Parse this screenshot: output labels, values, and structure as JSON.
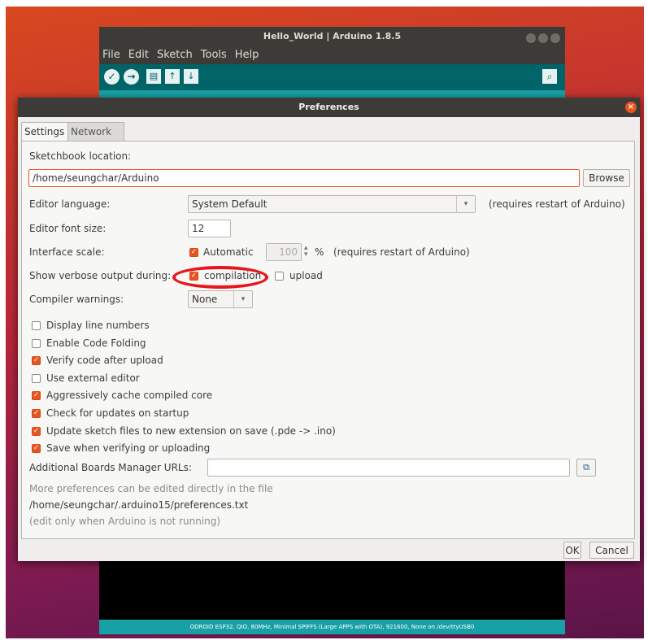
{
  "ide": {
    "title": "Hello_World | Arduino 1.8.5",
    "menu": [
      "File",
      "Edit",
      "Sketch",
      "Tools",
      "Help"
    ],
    "toolbar_icons": [
      "verify-icon",
      "upload-icon",
      "new-icon",
      "open-icon",
      "save-icon"
    ],
    "serial_icon": "serial-monitor-icon",
    "status": "ODROID ESP32, QIO, 80MHz, Minimal SPIFFS (Large APPS with OTA), 921600, None on /dev/ttyUSB0"
  },
  "prefs": {
    "title": "Preferences",
    "tabs": [
      "Settings",
      "Network"
    ],
    "sketchbook_label": "Sketchbook location:",
    "sketchbook_value": "/home/seungchar/Arduino",
    "browse_label": "Browse",
    "editor_language_label": "Editor language:",
    "editor_language_value": "System Default",
    "editor_language_note": "(requires restart of Arduino)",
    "font_size_label": "Editor font size:",
    "font_size_value": "12",
    "interface_scale_label": "Interface scale:",
    "interface_scale_auto": "Automatic",
    "interface_scale_value": "100",
    "interface_scale_unit": "%",
    "interface_scale_note": "(requires restart of Arduino)",
    "verbose_label": "Show verbose output during:",
    "verbose_compilation": "compilation",
    "verbose_upload": "upload",
    "warnings_label": "Compiler warnings:",
    "warnings_value": "None",
    "options": [
      {
        "label": "Display line numbers",
        "checked": false
      },
      {
        "label": "Enable Code Folding",
        "checked": false
      },
      {
        "label": "Verify code after upload",
        "checked": true
      },
      {
        "label": "Use external editor",
        "checked": false
      },
      {
        "label": "Aggressively cache compiled core",
        "checked": true
      },
      {
        "label": "Check for updates on startup",
        "checked": true
      },
      {
        "label": "Update sketch files to new extension on save (.pde -> .ino)",
        "checked": true
      },
      {
        "label": "Save when verifying or uploading",
        "checked": true
      }
    ],
    "boards_urls_label": "Additional Boards Manager URLs:",
    "boards_urls_value": "",
    "more_prefs_line1": "More preferences can be edited directly in the file",
    "more_prefs_path": "/home/seungchar/.arduino15/preferences.txt",
    "more_prefs_line3": "(edit only when Arduino is not running)",
    "ok_label": "OK",
    "cancel_label": "Cancel",
    "accent_color": "#e95420"
  }
}
